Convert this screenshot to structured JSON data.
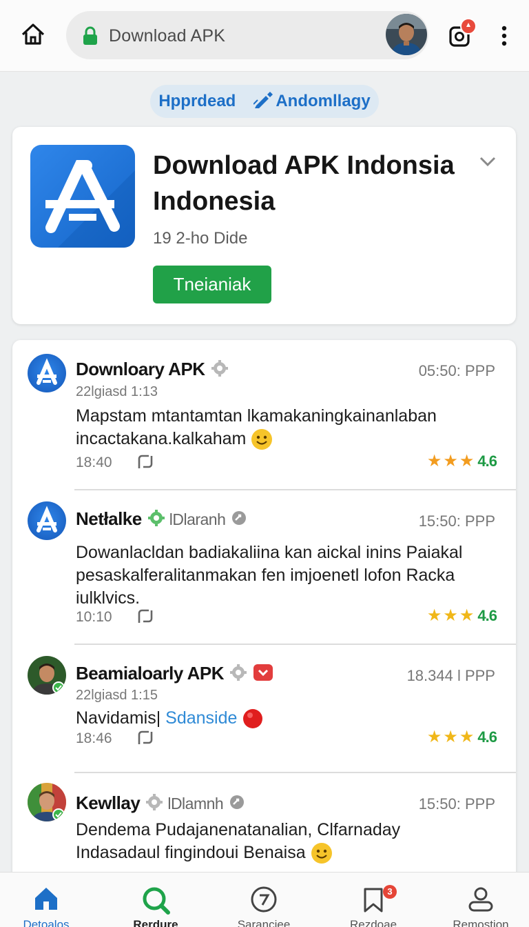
{
  "topbar": {
    "url": "Download APK"
  },
  "chip": {
    "left": "Hpprdead",
    "right": "Andomllagy"
  },
  "hero": {
    "title_line1": "Download APK Indonsia",
    "title_line2": "Indonesia",
    "meta": "19 2-ho Dide",
    "button": "Tneianiak"
  },
  "posts": [
    {
      "name": "Downloary APK",
      "handle": "",
      "time": "05:50: PPP",
      "sub": "22lgiasd 1:13",
      "body": "Mapstam mtantamtan lkamakaningkainanlaban incactakana.kalkaham",
      "meta_time": "18:40",
      "rating": "4.6"
    },
    {
      "name": "Netłalke",
      "handle": "lDlaranh",
      "time": "15:50: PPP",
      "sub": "",
      "body": "Dowanlacldan badiakaliina kan aickal inins Paiakal pesaskalferalitanmakan fen imjoenetl lofon Racka iulklvics.",
      "meta_time": "10:10",
      "rating": "4.6"
    },
    {
      "name": "Beamialoarly APK",
      "handle": "",
      "time": "18.344 l PPP",
      "sub": "22lgiasd 1:15",
      "body_plain": "Navidamis|",
      "body_link": "Sdanside",
      "meta_time": "18:46",
      "rating": "4.6"
    },
    {
      "name": "Kewllay",
      "handle": "lDlamnh",
      "time": "15:50: PPP",
      "sub": "",
      "body": "Dendema Pudajanenatanalian, Clfarnaday Indasadaul fingindoui Benaisa"
    }
  ],
  "nav": [
    {
      "label": "Detoalos",
      "icon": "home-icon"
    },
    {
      "label": "Rerdure",
      "icon": "search-icon"
    },
    {
      "label": "Saranciee",
      "icon": "compass-icon"
    },
    {
      "label": "Rezdoae",
      "icon": "bookmark-icon",
      "badge": "3"
    },
    {
      "label": "Remostion",
      "icon": "profile-icon"
    }
  ],
  "colors": {
    "accent": "#1d6fc7",
    "primary_button": "#21a148",
    "star": "#f29c1f",
    "rating": "#1d9a44"
  }
}
